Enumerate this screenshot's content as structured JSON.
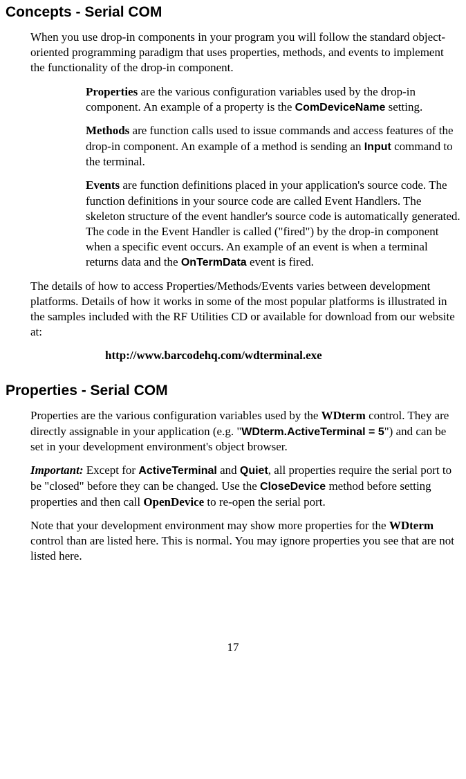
{
  "section1": {
    "heading": "Concepts  - Serial COM",
    "intro": "When you use drop-in components in your program you will follow the standard object-oriented programming paradigm that uses properties, methods, and events to implement the functionality of the drop-in component.",
    "defs": {
      "properties": {
        "term": "Properties",
        "text1": " are the various configuration variables used by the drop-in component. An example of a property is the ",
        "code": "ComDeviceName",
        "text2": " setting."
      },
      "methods": {
        "term": "Methods",
        "text1": " are function calls used to issue commands and access features of the drop-in component. An example of a method is sending an ",
        "code": "Input",
        "text2": " command to the terminal."
      },
      "events": {
        "term": "Events",
        "text1": " are function definitions placed in your application's source code. The function definitions in your source code are called Event Handlers. The skeleton structure of the event handler's source code is automatically generated. The code in the Event Handler is called (\"fired\") by the drop-in component when a specific event occurs. An example of an event is when a terminal returns data and the ",
        "code": "OnTermData",
        "text2": " event is fired."
      }
    },
    "details": "The details of how to access Properties/Methods/Events varies between development platforms. Details of how it works in some of the most popular platforms is illustrated in the samples included with the RF Utilities CD or available for download from our website at:",
    "url": "http://www.barcodehq.com/wdterminal.exe"
  },
  "section2": {
    "heading": "Properties - Serial COM",
    "p1": {
      "t1": "Properties are the various configuration variables used by the ",
      "b1": "WDterm",
      "t2": " control. They are directly assignable in your application (e.g. \"",
      "c1": "WDterm.ActiveTerminal = 5",
      "t3": "\") and can be set in your development environment's object browser."
    },
    "p2": {
      "em": "Important:",
      "t1": " Except for ",
      "c1": "ActiveTerminal",
      "t2": " and ",
      "c2": "Quiet",
      "t3": ", all properties require the serial port to be \"closed\" before they can be changed. Use the ",
      "c3": "CloseDevice",
      "t4": " method before setting properties and then call ",
      "b1": "OpenDevice",
      "t5": " to re-open the serial port."
    },
    "p3": {
      "t1": "Note that your development environment may show more properties for the ",
      "b1": "WDterm",
      "t2": " control than are listed here. This is normal. You may ignore properties you see that are not listed here."
    }
  },
  "pageNumber": "17"
}
